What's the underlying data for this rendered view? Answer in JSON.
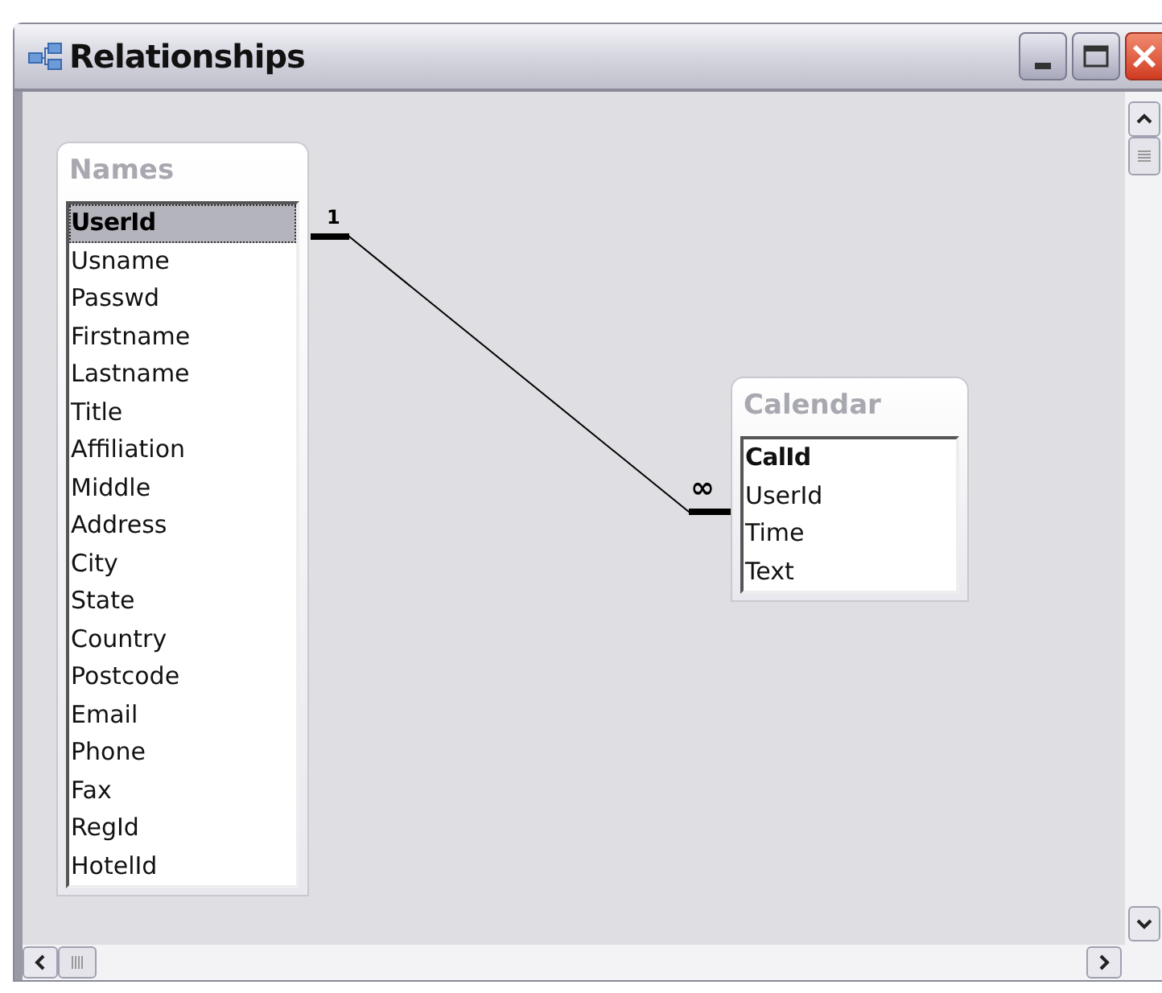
{
  "window": {
    "title": "Relationships"
  },
  "tables": [
    {
      "name": "Names",
      "fields": [
        {
          "text": "UserId",
          "key": true,
          "selected": true
        },
        {
          "text": "Usname",
          "key": false,
          "selected": false
        },
        {
          "text": "Passwd",
          "key": false,
          "selected": false
        },
        {
          "text": "Firstname",
          "key": false,
          "selected": false
        },
        {
          "text": "Lastname",
          "key": false,
          "selected": false
        },
        {
          "text": "Title",
          "key": false,
          "selected": false
        },
        {
          "text": "Affiliation",
          "key": false,
          "selected": false
        },
        {
          "text": "Middle",
          "key": false,
          "selected": false
        },
        {
          "text": "Address",
          "key": false,
          "selected": false
        },
        {
          "text": "City",
          "key": false,
          "selected": false
        },
        {
          "text": "State",
          "key": false,
          "selected": false
        },
        {
          "text": "Country",
          "key": false,
          "selected": false
        },
        {
          "text": "Postcode",
          "key": false,
          "selected": false
        },
        {
          "text": "Email",
          "key": false,
          "selected": false
        },
        {
          "text": "Phone",
          "key": false,
          "selected": false
        },
        {
          "text": "Fax",
          "key": false,
          "selected": false
        },
        {
          "text": "RegId",
          "key": false,
          "selected": false
        },
        {
          "text": "HotelId",
          "key": false,
          "selected": false
        }
      ]
    },
    {
      "name": "Calendar",
      "fields": [
        {
          "text": "CalId",
          "key": true,
          "selected": false
        },
        {
          "text": "UserId",
          "key": false,
          "selected": false
        },
        {
          "text": "Time",
          "key": false,
          "selected": false
        },
        {
          "text": "Text",
          "key": false,
          "selected": false
        }
      ]
    }
  ],
  "relationship": {
    "from_label": "1",
    "to_label": "∞"
  }
}
